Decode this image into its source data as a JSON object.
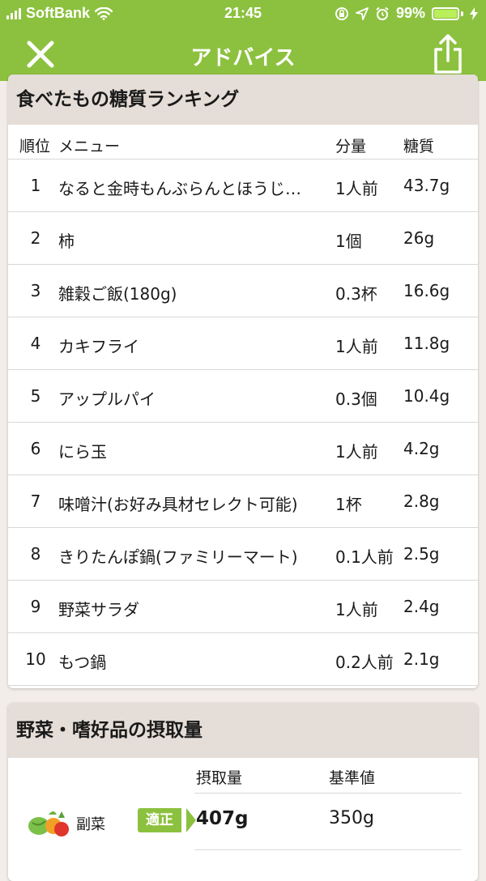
{
  "status_bar": {
    "carrier": "SoftBank",
    "time": "21:45",
    "battery_percent": "99%",
    "battery_color": "#b8ef5a"
  },
  "nav": {
    "title": "アドバイス",
    "close_icon": "close-icon",
    "share_icon": "share-icon",
    "accent_color": "#8cc13f"
  },
  "ranking": {
    "title": "食べたもの糖質ランキング",
    "headers": {
      "rank": "順位",
      "menu": "メニュー",
      "amount": "分量",
      "carb": "糖質"
    },
    "rows": [
      {
        "rank": "1",
        "menu": "なると金時もんぶらんとほうじ…",
        "amount": "1人前",
        "carb": "43.7g"
      },
      {
        "rank": "2",
        "menu": "柿",
        "amount": "1個",
        "carb": "26g"
      },
      {
        "rank": "3",
        "menu": "雑穀ご飯(180g)",
        "amount": "0.3杯",
        "carb": "16.6g"
      },
      {
        "rank": "4",
        "menu": "カキフライ",
        "amount": "1人前",
        "carb": "11.8g"
      },
      {
        "rank": "5",
        "menu": "アップルパイ",
        "amount": "0.3個",
        "carb": "10.4g"
      },
      {
        "rank": "6",
        "menu": "にら玉",
        "amount": "1人前",
        "carb": "4.2g"
      },
      {
        "rank": "7",
        "menu": "味噌汁(お好み具材セレクト可能)",
        "amount": "1杯",
        "carb": "2.8g"
      },
      {
        "rank": "8",
        "menu": "きりたんぽ鍋(ファミリーマート)",
        "amount": "0.1人前",
        "carb": "2.5g"
      },
      {
        "rank": "9",
        "menu": "野菜サラダ",
        "amount": "1人前",
        "carb": "2.4g"
      },
      {
        "rank": "10",
        "menu": "もつ鍋",
        "amount": "0.2人前",
        "carb": "2.1g"
      }
    ]
  },
  "intake": {
    "title": "野菜・嗜好品の摂取量",
    "headers": {
      "intake": "摂取量",
      "standard": "基準値"
    },
    "rows": [
      {
        "category": "副菜",
        "icon": "vegetables-icon",
        "badge": "適正",
        "intake": "407g",
        "standard": "350g"
      }
    ]
  }
}
